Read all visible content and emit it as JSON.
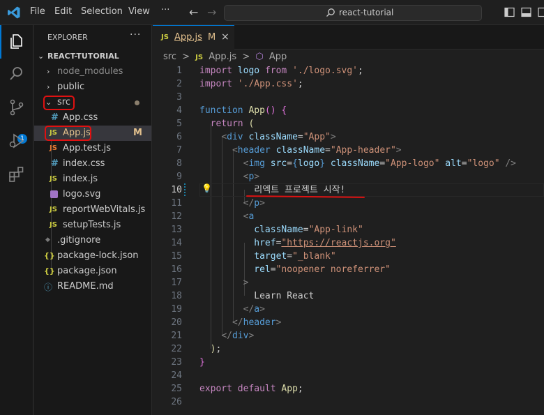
{
  "titlebar": {
    "menu": [
      "File",
      "Edit",
      "Selection",
      "View",
      "···"
    ],
    "search_text": "react-tutorial"
  },
  "activity": {
    "source_control_badge": "1"
  },
  "explorer": {
    "title": "EXPLORER",
    "more": "···",
    "root": "REACT-TUTORIAL",
    "items": [
      {
        "name": "node_modules",
        "kind": "folder",
        "state": "collapsed"
      },
      {
        "name": "public",
        "kind": "folder",
        "state": "collapsed"
      },
      {
        "name": "src",
        "kind": "folder",
        "state": "expanded",
        "decoration": "dot"
      },
      {
        "name": "App.css",
        "kind": "css",
        "icon": "#"
      },
      {
        "name": "App.js",
        "kind": "js",
        "icon": "JS",
        "decoration": "M",
        "selected": true
      },
      {
        "name": "App.test.js",
        "kind": "js",
        "icon": "JS"
      },
      {
        "name": "index.css",
        "kind": "css",
        "icon": "#"
      },
      {
        "name": "index.js",
        "kind": "js",
        "icon": "JS"
      },
      {
        "name": "logo.svg",
        "kind": "svg",
        "icon": "svg"
      },
      {
        "name": "reportWebVitals.js",
        "kind": "js",
        "icon": "JS"
      },
      {
        "name": "setupTests.js",
        "kind": "js",
        "icon": "JS"
      },
      {
        "name": ".gitignore",
        "kind": "git",
        "icon": "◆"
      },
      {
        "name": "package-lock.json",
        "kind": "json",
        "icon": "{}"
      },
      {
        "name": "package.json",
        "kind": "json",
        "icon": "{}"
      },
      {
        "name": "README.md",
        "kind": "info",
        "icon": "ⓘ"
      }
    ]
  },
  "editor": {
    "tab": {
      "icon": "JS",
      "label": "App.js",
      "status": "M",
      "close": "×"
    },
    "breadcrumb": [
      "src",
      ">",
      "JS",
      "App.js",
      ">",
      "⬡",
      "App"
    ],
    "active_line": 10,
    "lines": [
      {
        "n": "1",
        "t": [
          [
            "kw2",
            "import "
          ],
          [
            "var",
            "logo "
          ],
          [
            "kw2",
            "from "
          ],
          [
            "str",
            "'./logo.svg'"
          ],
          [
            "",
            "; "
          ]
        ]
      },
      {
        "n": "2",
        "t": [
          [
            "kw2",
            "import "
          ],
          [
            "str",
            "'./App.css'"
          ],
          [
            "",
            ";"
          ]
        ]
      },
      {
        "n": "3",
        "t": []
      },
      {
        "n": "4",
        "t": [
          [
            "kw",
            "function "
          ],
          [
            "fn",
            "App"
          ],
          [
            "brace",
            "() "
          ],
          [
            "brace",
            "{"
          ]
        ]
      },
      {
        "n": "5",
        "t": [
          [
            "",
            "  "
          ],
          [
            "kw2",
            "return "
          ],
          [
            "fn",
            "("
          ]
        ]
      },
      {
        "n": "6",
        "t": [
          [
            "",
            "    "
          ],
          [
            "punct",
            "<"
          ],
          [
            "tag",
            "div "
          ],
          [
            "var",
            "className"
          ],
          [
            "",
            "="
          ],
          [
            "str",
            "\"App\""
          ],
          [
            "punct",
            ">"
          ]
        ]
      },
      {
        "n": "7",
        "t": [
          [
            "",
            "      "
          ],
          [
            "punct",
            "<"
          ],
          [
            "tag",
            "header "
          ],
          [
            "var",
            "className"
          ],
          [
            "",
            "="
          ],
          [
            "str",
            "\"App-header\""
          ],
          [
            "punct",
            ">"
          ]
        ]
      },
      {
        "n": "8",
        "t": [
          [
            "",
            "        "
          ],
          [
            "punct",
            "<"
          ],
          [
            "tag",
            "img "
          ],
          [
            "var",
            "src"
          ],
          [
            "",
            "="
          ],
          [
            "kw",
            "{"
          ],
          [
            "var",
            "logo"
          ],
          [
            "kw",
            "} "
          ],
          [
            "var",
            "className"
          ],
          [
            "",
            "="
          ],
          [
            "str",
            "\"App-logo\" "
          ],
          [
            "var",
            "alt"
          ],
          [
            "",
            "="
          ],
          [
            "str",
            "\"logo\" "
          ],
          [
            "punct",
            "/>"
          ]
        ]
      },
      {
        "n": "9",
        "t": [
          [
            "",
            "        "
          ],
          [
            "punct",
            "<"
          ],
          [
            "tag",
            "p"
          ],
          [
            "punct",
            ">"
          ]
        ]
      },
      {
        "n": "10",
        "t": [
          [
            "",
            "          리엑트 프로젝트 시작!"
          ]
        ]
      },
      {
        "n": "11",
        "t": [
          [
            "",
            "        "
          ],
          [
            "punct",
            "</"
          ],
          [
            "tag",
            "p"
          ],
          [
            "punct",
            ">"
          ]
        ]
      },
      {
        "n": "12",
        "t": [
          [
            "",
            "        "
          ],
          [
            "punct",
            "<"
          ],
          [
            "tag",
            "a"
          ]
        ]
      },
      {
        "n": "13",
        "t": [
          [
            "",
            "          "
          ],
          [
            "var",
            "className"
          ],
          [
            "",
            "="
          ],
          [
            "str",
            "\"App-link\""
          ]
        ]
      },
      {
        "n": "14",
        "t": [
          [
            "",
            "          "
          ],
          [
            "var",
            "href"
          ],
          [
            "",
            "="
          ],
          [
            "str",
            "\"https://reactjs.org\""
          ]
        ]
      },
      {
        "n": "15",
        "t": [
          [
            "",
            "          "
          ],
          [
            "var",
            "target"
          ],
          [
            "",
            "="
          ],
          [
            "str",
            "\"_blank\""
          ]
        ]
      },
      {
        "n": "16",
        "t": [
          [
            "",
            "          "
          ],
          [
            "var",
            "rel"
          ],
          [
            "",
            "="
          ],
          [
            "str",
            "\"noopener noreferrer\""
          ]
        ]
      },
      {
        "n": "17",
        "t": [
          [
            "",
            "        "
          ],
          [
            "punct",
            ">"
          ]
        ]
      },
      {
        "n": "18",
        "t": [
          [
            "",
            "          Learn React"
          ]
        ]
      },
      {
        "n": "19",
        "t": [
          [
            "",
            "        "
          ],
          [
            "punct",
            "</"
          ],
          [
            "tag",
            "a"
          ],
          [
            "punct",
            ">"
          ]
        ]
      },
      {
        "n": "20",
        "t": [
          [
            "",
            "      "
          ],
          [
            "punct",
            "</"
          ],
          [
            "tag",
            "header"
          ],
          [
            "punct",
            ">"
          ]
        ]
      },
      {
        "n": "21",
        "t": [
          [
            "",
            "    "
          ],
          [
            "punct",
            "</"
          ],
          [
            "tag",
            "div"
          ],
          [
            "punct",
            ">"
          ]
        ]
      },
      {
        "n": "22",
        "t": [
          [
            "",
            "  "
          ],
          [
            "fn",
            ")"
          ],
          [
            "",
            ";"
          ]
        ]
      },
      {
        "n": "23",
        "t": [
          [
            "brace",
            "}"
          ]
        ]
      },
      {
        "n": "24",
        "t": []
      },
      {
        "n": "25",
        "t": [
          [
            "kw2",
            "export "
          ],
          [
            "kw2",
            "default "
          ],
          [
            "fn",
            "App"
          ],
          [
            "",
            ";"
          ]
        ]
      },
      {
        "n": "26",
        "t": []
      }
    ]
  },
  "colors": {
    "accent": "#0078d4",
    "annotation": "#e01111",
    "modified": "#e2c08d"
  }
}
